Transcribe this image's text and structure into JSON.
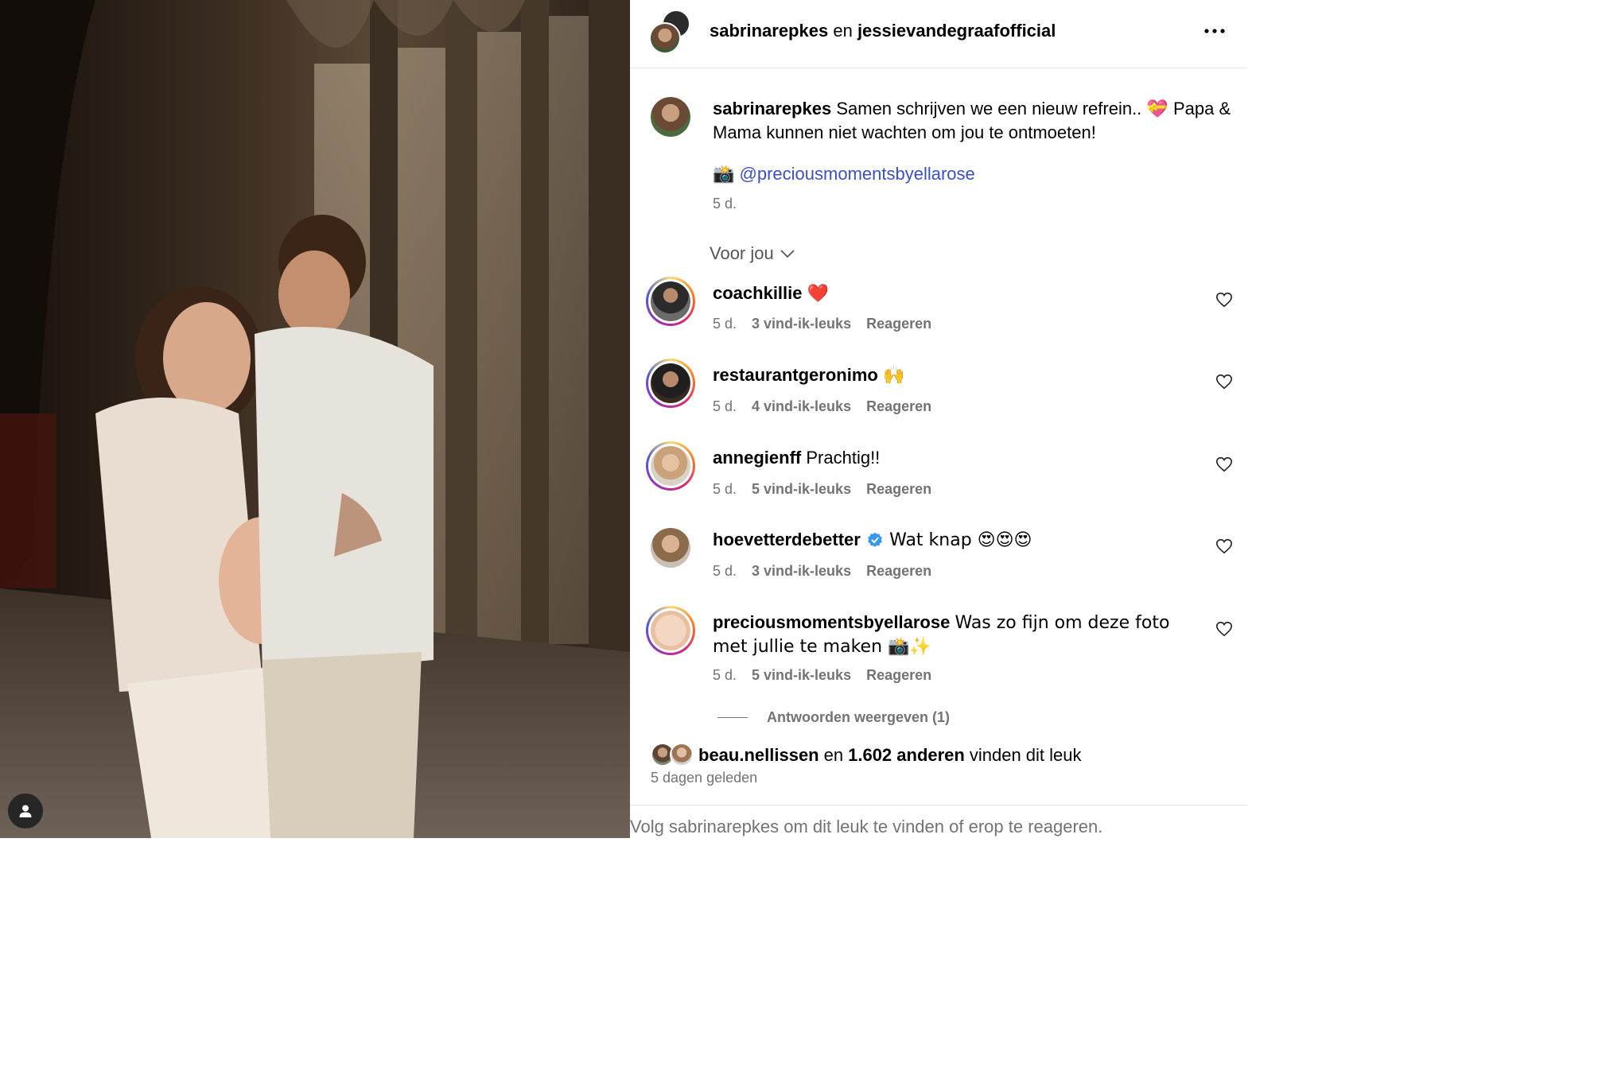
{
  "post": {
    "author": "sabrinarepkes",
    "joiner": "en",
    "coauthor": "jessievandegraafofficial",
    "more_icon": "more-horizontal-icon"
  },
  "caption": {
    "username": "sabrinarepkes",
    "text_before_emoji": "Samen schrijven we een nieuw refrein..",
    "emoji": "💝",
    "text_after_emoji": "Papa & Mama kunnen niet wachten om jou te ontmoeten!",
    "camera_emoji": "📸",
    "mention": "@preciousmomentsbyellarose",
    "time": "5 d."
  },
  "filter": {
    "label": "Voor jou",
    "icon": "chevron-down-icon"
  },
  "comments": [
    {
      "username": "coachkillie",
      "text": "❤️",
      "time": "5 d.",
      "likes": "3 vind-ik-leuks",
      "reply": "Reageren",
      "story_ring": true,
      "verified": false
    },
    {
      "username": "restaurantgeronimo",
      "text": "🙌",
      "time": "5 d.",
      "likes": "4 vind-ik-leuks",
      "reply": "Reageren",
      "story_ring": true,
      "verified": false
    },
    {
      "username": "annegienff",
      "text": "Prachtig!!",
      "time": "5 d.",
      "likes": "5 vind-ik-leuks",
      "reply": "Reageren",
      "story_ring": true,
      "verified": false
    },
    {
      "username": "hoevetterdebetter",
      "text": "Wat knap 😍😍😍",
      "time": "5 d.",
      "likes": "3 vind-ik-leuks",
      "reply": "Reageren",
      "story_ring": false,
      "verified": true
    },
    {
      "username": "preciousmomentsbyellarose",
      "text": "Was zo fijn om deze foto met jullie te maken 📸✨",
      "time": "5 d.",
      "likes": "5 vind-ik-leuks",
      "reply": "Reageren",
      "story_ring": true,
      "verified": false
    }
  ],
  "view_replies": "Antwoorden weergeven (1)",
  "likes_summary": {
    "user": "beau.nellissen",
    "joiner": "en",
    "others": "1.602 anderen",
    "suffix": "vinden dit leuk"
  },
  "posted": "5 dagen geleden",
  "footer": "Volg sabrinarepkes om dit leuk te vinden of erop te reageren.",
  "colors": {
    "link": "#3a4fc7",
    "muted": "#737373",
    "verified": "#3897f0",
    "heart_red": "#e0245e"
  }
}
